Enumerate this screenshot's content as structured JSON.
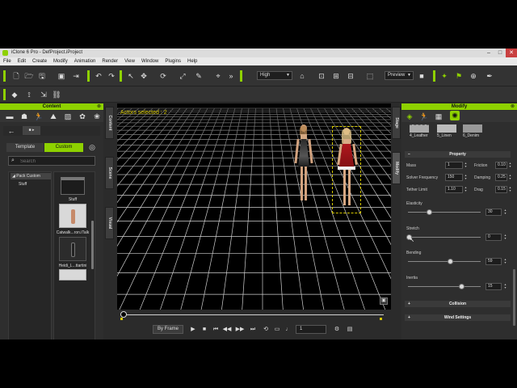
{
  "window": {
    "title": "iClone 6 Pro - DefProject.iProject"
  },
  "menu": [
    "File",
    "Edit",
    "Create",
    "Modify",
    "Animation",
    "Render",
    "View",
    "Window",
    "Plugins",
    "Help"
  ],
  "toolbar": {
    "quality": "High",
    "preview": "Preview"
  },
  "content_panel": {
    "title": "Content",
    "tabs": {
      "template": "Template",
      "custom": "Custom"
    },
    "search_placeholder": "Search",
    "tree": [
      "Pack Custom",
      "Stuff"
    ],
    "items": [
      "Stuff",
      "Catwalk...ron.iTalk",
      "Heidi_L...ttartini",
      ""
    ]
  },
  "side_tabs": {
    "content": "Content",
    "scene": "Scene",
    "visual": "Visual",
    "stage": "Stage",
    "modify": "Modify"
  },
  "viewport": {
    "overlay_text": "Actors selected : 2"
  },
  "timeline": {
    "mode": "By Frame",
    "frame": "1"
  },
  "modify_panel": {
    "title": "Modify",
    "materials": [
      "4_Leather",
      "5_Linen",
      "6_Denim"
    ],
    "property_section": "Property",
    "mass": {
      "label": "Mass",
      "value": "1"
    },
    "friction": {
      "label": "Friction",
      "value": "0.10"
    },
    "solver_freq": {
      "label": "Solver Frequency",
      "value": "150"
    },
    "damping": {
      "label": "Damping",
      "value": "0.25"
    },
    "tether_limit": {
      "label": "Tether Limit",
      "value": "1.10"
    },
    "drag": {
      "label": "Drag",
      "value": "0.15"
    },
    "elasticity": {
      "label": "Elasticity",
      "value": "30"
    },
    "stretch": {
      "label": "Stretch",
      "value": "0"
    },
    "bending": {
      "label": "Bending",
      "value": "59"
    },
    "inertia": {
      "label": "Inertia",
      "value": "15"
    },
    "collision_section": "Collision",
    "wind_section": "Wind Settings"
  },
  "colors": {
    "accent": "#8ed100",
    "panel": "#2e2e2e",
    "viewport": "#000000"
  }
}
